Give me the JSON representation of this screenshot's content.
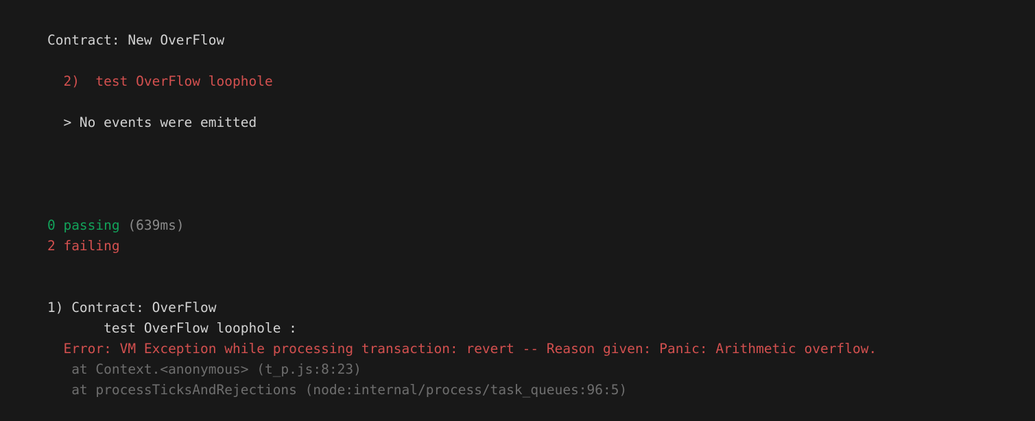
{
  "terminal": {
    "background_color": "#181818",
    "default_text_color": "#d2d2d2",
    "pass_color": "#12a25a",
    "fail_color": "#d3504f",
    "dim_color": "#8a8a8a",
    "stack_color": "#6e6e6e"
  },
  "suite": {
    "title": "Contract: New OverFlow"
  },
  "failing_test_entry": {
    "marker": "  2) ",
    "name": " test OverFlow loophole"
  },
  "events_note": {
    "text": "  > No events were emitted"
  },
  "summary": {
    "passing_count": "0 passing ",
    "passing_duration": "(639ms)",
    "failing_count": "2 failing"
  },
  "failure_detail": {
    "index_and_suite": "1) Contract: OverFlow",
    "test_name": "       test OverFlow loophole :",
    "error_message": "  Error: VM Exception while processing transaction: revert -- Reason given: Panic: Arithmetic overflow.",
    "stack": [
      "   at Context.<anonymous> (t_p.js:8:23)",
      "   at processTicksAndRejections (node:internal/process/task_queues:96:5)"
    ]
  }
}
